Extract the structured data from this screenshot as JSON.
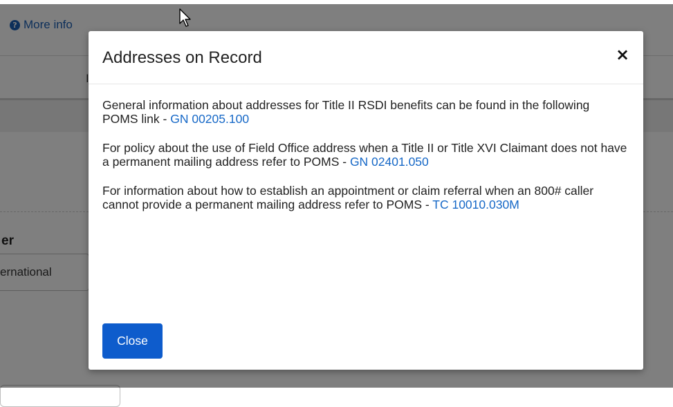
{
  "background": {
    "more_info_label": "More info",
    "partial_heading": "I",
    "field_label": "er",
    "select_value": "ernational"
  },
  "modal": {
    "title": "Addresses on Record",
    "close_icon": "×",
    "paragraphs": [
      {
        "text": "General information about addresses for Title II RSDI benefits can be found in the following POMS link - ",
        "link_text": "GN 00205.100"
      },
      {
        "text": "For policy about the use of Field Office address when a Title II or Title XVI Claimant does not have a permanent mailing address refer to POMS - ",
        "link_text": "GN 02401.050"
      },
      {
        "text": "For information about how to establish an appointment or claim referral when an 800# caller cannot provide a permanent mailing address refer to POMS - ",
        "link_text": "TC 10010.030M"
      }
    ],
    "close_button_label": "Close"
  },
  "colors": {
    "link": "#1668c7",
    "primary_button": "#0e5ccc",
    "overlay": "rgba(0,0,0,0.5)"
  }
}
